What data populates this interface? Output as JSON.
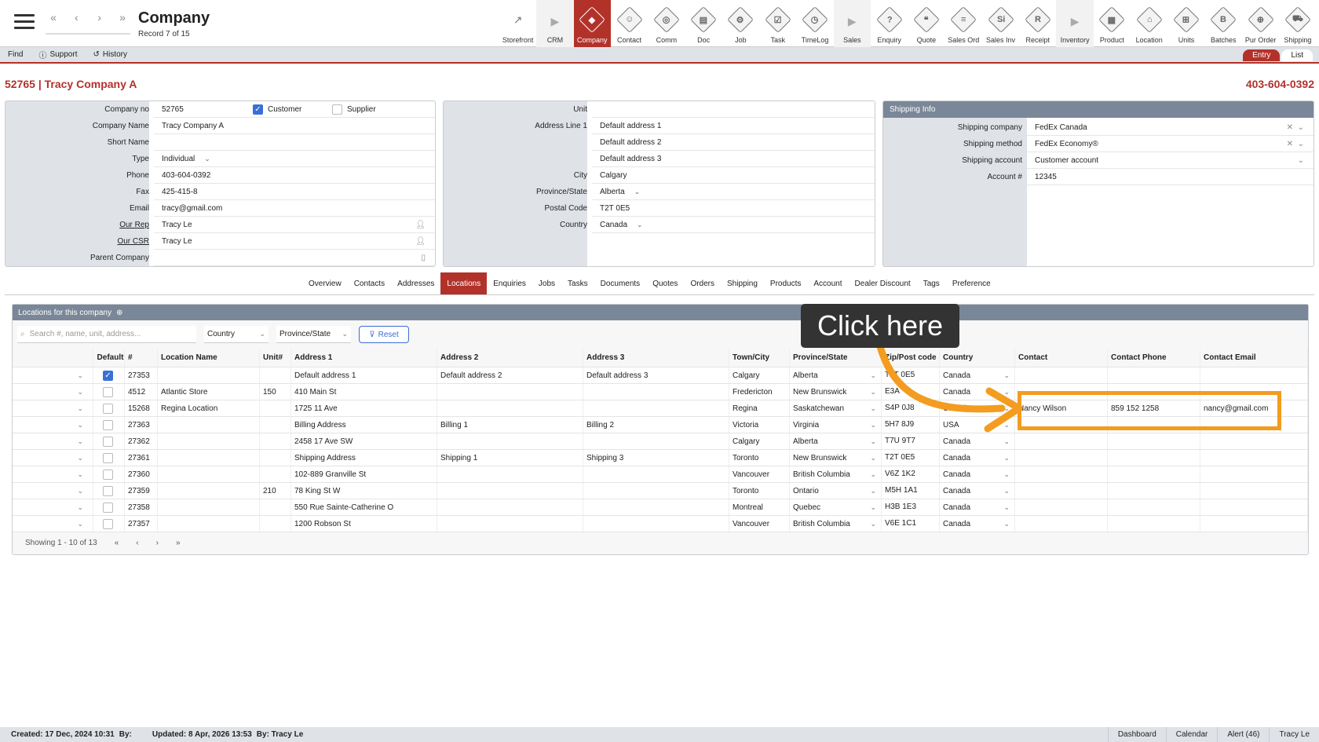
{
  "header": {
    "title": "Company",
    "record": "Record 7 of 15",
    "nav": [
      "«",
      "‹",
      "›",
      "»"
    ]
  },
  "modules": [
    {
      "label": "Storefront",
      "glyph": "↗",
      "type": "plain"
    },
    {
      "label": "CRM",
      "glyph": "▶",
      "type": "sep"
    },
    {
      "label": "Company",
      "glyph": "◆",
      "type": "active"
    },
    {
      "label": "Contact",
      "glyph": "☺",
      "type": "icon"
    },
    {
      "label": "Comm",
      "glyph": "◎",
      "type": "icon"
    },
    {
      "label": "Doc",
      "glyph": "▤",
      "type": "icon"
    },
    {
      "label": "Job",
      "glyph": "⚙",
      "type": "icon"
    },
    {
      "label": "Task",
      "glyph": "☑",
      "type": "icon"
    },
    {
      "label": "TimeLog",
      "glyph": "◷",
      "type": "icon"
    },
    {
      "label": "Sales",
      "glyph": "▶",
      "type": "sep"
    },
    {
      "label": "Enquiry",
      "glyph": "?",
      "type": "icon"
    },
    {
      "label": "Quote",
      "glyph": "❝",
      "type": "icon"
    },
    {
      "label": "Sales Ord",
      "glyph": "≡",
      "type": "icon"
    },
    {
      "label": "Sales Inv",
      "glyph": "Si",
      "type": "icon"
    },
    {
      "label": "Receipt",
      "glyph": "R",
      "type": "icon"
    },
    {
      "label": "Inventory",
      "glyph": "▶",
      "type": "sep"
    },
    {
      "label": "Product",
      "glyph": "▦",
      "type": "icon"
    },
    {
      "label": "Location",
      "glyph": "⌂",
      "type": "icon"
    },
    {
      "label": "Units",
      "glyph": "⊞",
      "type": "icon"
    },
    {
      "label": "Batches",
      "glyph": "B",
      "type": "icon"
    },
    {
      "label": "Pur Order",
      "glyph": "⊕",
      "type": "icon"
    },
    {
      "label": "Shipping",
      "glyph": "⛟",
      "type": "icon"
    }
  ],
  "toolbar": {
    "find": "Find",
    "support": "Support",
    "history": "History",
    "entry": "Entry",
    "list": "List"
  },
  "company": {
    "heading": "52765 | Tracy Company A",
    "phone_heading": "403-604-0392"
  },
  "general": {
    "company_no_label": "Company no",
    "company_no": "52765",
    "customer_label": "Customer",
    "supplier_label": "Supplier",
    "customer_checked": true,
    "supplier_checked": false,
    "company_name_label": "Company Name",
    "company_name": "Tracy Company A",
    "short_name_label": "Short Name",
    "short_name": "",
    "type_label": "Type",
    "type": "Individual",
    "phone_label": "Phone",
    "phone": "403-604-0392",
    "fax_label": "Fax",
    "fax": "425-415-8",
    "email_label": "Email",
    "email": "tracy@gmail.com",
    "rep_label": "Our Rep",
    "rep": "Tracy Le",
    "csr_label": "Our CSR",
    "csr": "Tracy Le",
    "parent_label": "Parent Company",
    "parent": ""
  },
  "address": {
    "unit_label": "Unit",
    "unit": "",
    "line1_label": "Address Line 1",
    "line1": "Default address 1",
    "line2": "Default address 2",
    "line3": "Default address 3",
    "city_label": "City",
    "city": "Calgary",
    "province_label": "Province/State",
    "province": "Alberta",
    "postal_label": "Postal Code",
    "postal": "T2T 0E5",
    "country_label": "Country",
    "country": "Canada"
  },
  "shipping": {
    "title": "Shipping Info",
    "company_label": "Shipping company",
    "company": "FedEx Canada",
    "method_label": "Shipping method",
    "method": "FedEx Economy®",
    "account_label": "Shipping account",
    "account": "Customer account",
    "account_no_label": "Account #",
    "account_no": "12345"
  },
  "tabs": [
    "Overview",
    "Contacts",
    "Addresses",
    "Locations",
    "Enquiries",
    "Jobs",
    "Tasks",
    "Documents",
    "Quotes",
    "Orders",
    "Shipping",
    "Products",
    "Account",
    "Dealer Discount",
    "Tags",
    "Preference"
  ],
  "active_tab": "Locations",
  "locations": {
    "title": "Locations for this company",
    "search_placeholder": "Search #, name, unit, address...",
    "country_filter": "Country",
    "province_filter": "Province/State",
    "reset": "Reset",
    "columns": [
      "Default",
      "#",
      "Location Name",
      "Unit#",
      "Address 1",
      "Address 2",
      "Address 3",
      "Town/City",
      "Province/State",
      "Zip/Post code",
      "Country",
      "Contact",
      "Contact Phone",
      "Contact Email"
    ],
    "rows": [
      {
        "default": true,
        "no": "27353",
        "name": "",
        "unit": "",
        "a1": "Default address 1",
        "a2": "Default address 2",
        "a3": "Default address 3",
        "city": "Calgary",
        "prov": "Alberta",
        "zip": "T2T 0E5",
        "country": "Canada",
        "contact": "",
        "cphone": "",
        "cemail": ""
      },
      {
        "default": false,
        "no": "4512",
        "name": "Atlantic Store",
        "unit": "150",
        "a1": "410 Main St",
        "a2": "",
        "a3": "",
        "city": "Fredericton",
        "prov": "New Brunswick",
        "zip": "E3A",
        "country": "Canada",
        "contact": "",
        "cphone": "",
        "cemail": ""
      },
      {
        "default": false,
        "no": "15268",
        "name": "Regina Location",
        "unit": "",
        "a1": "1725 11 Ave",
        "a2": "",
        "a3": "",
        "city": "Regina",
        "prov": "Saskatchewan",
        "zip": "S4P 0J8",
        "country": "Canada",
        "contact": "Nancy Wilson",
        "cphone": "859 152 1258",
        "cemail": "nancy@gmail.com"
      },
      {
        "default": false,
        "no": "27363",
        "name": "",
        "unit": "",
        "a1": "Billing Address",
        "a2": "Billing 1",
        "a3": "Billing 2",
        "city": "Victoria",
        "prov": "Virginia",
        "zip": "5H7 8J9",
        "country": "USA",
        "contact": "",
        "cphone": "",
        "cemail": ""
      },
      {
        "default": false,
        "no": "27362",
        "name": "",
        "unit": "",
        "a1": "2458 17 Ave SW",
        "a2": "",
        "a3": "",
        "city": "Calgary",
        "prov": "Alberta",
        "zip": "T7U 9T7",
        "country": "Canada",
        "contact": "",
        "cphone": "",
        "cemail": ""
      },
      {
        "default": false,
        "no": "27361",
        "name": "",
        "unit": "",
        "a1": "Shipping Address",
        "a2": "Shipping 1",
        "a3": "Shipping 3",
        "city": "Toronto",
        "prov": "New Brunswick",
        "zip": "T2T 0E5",
        "country": "Canada",
        "contact": "",
        "cphone": "",
        "cemail": ""
      },
      {
        "default": false,
        "no": "27360",
        "name": "",
        "unit": "",
        "a1": "102-889 Granville St",
        "a2": "",
        "a3": "",
        "city": "Vancouver",
        "prov": "British Columbia",
        "zip": "V6Z 1K2",
        "country": "Canada",
        "contact": "",
        "cphone": "",
        "cemail": ""
      },
      {
        "default": false,
        "no": "27359",
        "name": "",
        "unit": "210",
        "a1": "78 King St W",
        "a2": "",
        "a3": "",
        "city": "Toronto",
        "prov": "Ontario",
        "zip": "M5H 1A1",
        "country": "Canada",
        "contact": "",
        "cphone": "",
        "cemail": ""
      },
      {
        "default": false,
        "no": "27358",
        "name": "",
        "unit": "",
        "a1": "550 Rue Sainte-Catherine O",
        "a2": "",
        "a3": "",
        "city": "Montreal",
        "prov": "Quebec",
        "zip": "H3B 1E3",
        "country": "Canada",
        "contact": "",
        "cphone": "",
        "cemail": ""
      },
      {
        "default": false,
        "no": "27357",
        "name": "",
        "unit": "",
        "a1": "1200 Robson St",
        "a2": "",
        "a3": "",
        "city": "Vancouver",
        "prov": "British Columbia",
        "zip": "V6E 1C1",
        "country": "Canada",
        "contact": "",
        "cphone": "",
        "cemail": ""
      }
    ],
    "showing": "Showing 1 - 10 of 13",
    "pager": [
      "«",
      "‹",
      "›",
      "»"
    ]
  },
  "overlay": {
    "callout": "Click here",
    "highlight_color": "#f39c1f"
  },
  "footer": {
    "created": "Created: 17 Dec, 2024   10:31",
    "created_by": "By:",
    "updated": "Updated: 8 Apr, 2026   13:53",
    "updated_by": "By: Tracy Le",
    "links": [
      "Dashboard",
      "Calendar",
      "Alert (46)",
      "Tracy Le"
    ]
  },
  "colors": {
    "accent": "#b2322a",
    "panel_header": "#7a8798",
    "check": "#3a6fd8"
  }
}
